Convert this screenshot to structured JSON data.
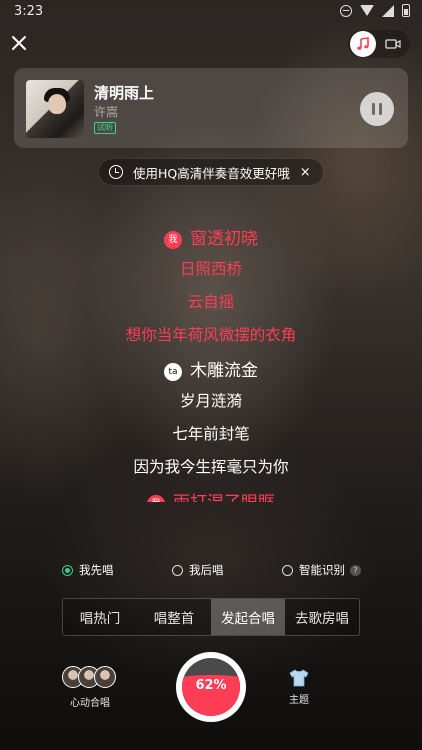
{
  "status_bar": {
    "time": "3:23"
  },
  "song": {
    "title": "清明雨上",
    "artist": "许嵩",
    "badge": "试听"
  },
  "hq_tip": {
    "text": "使用HQ高清伴奏音效更好哦",
    "close": "×"
  },
  "lyrics": [
    {
      "singer": "me",
      "tag": "我",
      "text": "窗透初晓",
      "first": true
    },
    {
      "singer": "me",
      "tag": "",
      "text": "日照西桥"
    },
    {
      "singer": "me",
      "tag": "",
      "text": "云自摇"
    },
    {
      "singer": "me",
      "tag": "",
      "text": "想你当年荷风微摆的衣角"
    },
    {
      "singer": "ta",
      "tag": "ta",
      "text": "木雕流金",
      "first": true
    },
    {
      "singer": "ta",
      "tag": "",
      "text": "岁月涟漪"
    },
    {
      "singer": "ta",
      "tag": "",
      "text": "七年前封笔"
    },
    {
      "singer": "ta",
      "tag": "",
      "text": "因为我今生挥毫只为你"
    },
    {
      "singer": "me",
      "tag": "我",
      "text": "雨打湿了眼眶",
      "first": true
    }
  ],
  "options": [
    {
      "label": "我先唱",
      "selected": true
    },
    {
      "label": "我后唱",
      "selected": false
    },
    {
      "label": "智能识别",
      "selected": false,
      "help": "?"
    }
  ],
  "tabs": [
    {
      "label": "唱热门",
      "active": false
    },
    {
      "label": "唱整首",
      "active": false
    },
    {
      "label": "发起合唱",
      "active": true
    },
    {
      "label": "去歌房唱",
      "active": false
    }
  ],
  "bottom": {
    "duet_label": "心动合唱",
    "record_progress_percent": 62,
    "record_label": "62%",
    "theme_label": "主题"
  },
  "colors": {
    "me": "#ff3d55",
    "ta": "#ffffff",
    "accent_green": "#39d08a"
  },
  "icons": [
    "close-icon",
    "music-note-icon",
    "video-icon",
    "pause-icon",
    "hq-info-icon",
    "shirt-icon"
  ]
}
